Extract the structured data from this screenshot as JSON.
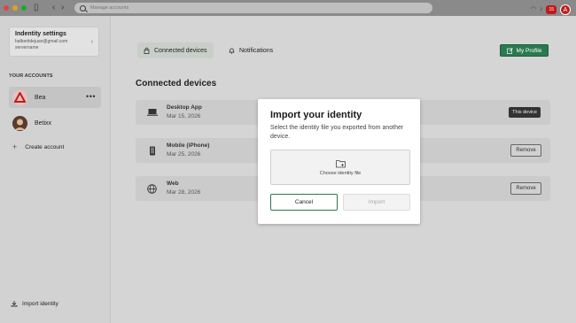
{
  "titlebar": {
    "search_placeholder": "Manage accounts",
    "notification_badge": "15",
    "avatar_letter": "A"
  },
  "sidebar": {
    "identity_card": {
      "title": "Indentity settings",
      "email": "balbertidejuan@gmail.com",
      "server": "servername"
    },
    "accounts_label": "YOUR ACCOUNTS",
    "accounts": [
      {
        "name": "Bea",
        "active": true
      },
      {
        "name": "Betixx",
        "active": false
      }
    ],
    "create_account_label": "Create account",
    "import_identity_label": "Import identity"
  },
  "main": {
    "tabs": [
      {
        "label": "Connected devices",
        "active": true
      },
      {
        "label": "Notifications",
        "active": false
      }
    ],
    "profile_button_label": "My Profile",
    "section_title": "Connected devices",
    "devices": [
      {
        "name": "Desktop App",
        "date": "Mar 15, 2026",
        "action": "This device",
        "icon": "laptop-icon"
      },
      {
        "name": "Mobile (iPhone)",
        "date": "Mar 25, 2026",
        "action": "Remove",
        "icon": "phone-icon"
      },
      {
        "name": "Web",
        "date": "Mar 28, 2026",
        "action": "Remove",
        "icon": "globe-icon"
      }
    ]
  },
  "modal": {
    "title": "Import your identity",
    "subtitle": "Select the identity file you exported from another device.",
    "dropzone_label": "Choose identity file",
    "cancel_label": "Cancel",
    "import_label": "Import"
  },
  "colors": {
    "accent_green": "#2a7a4f",
    "alert_red": "#c21a1a"
  }
}
